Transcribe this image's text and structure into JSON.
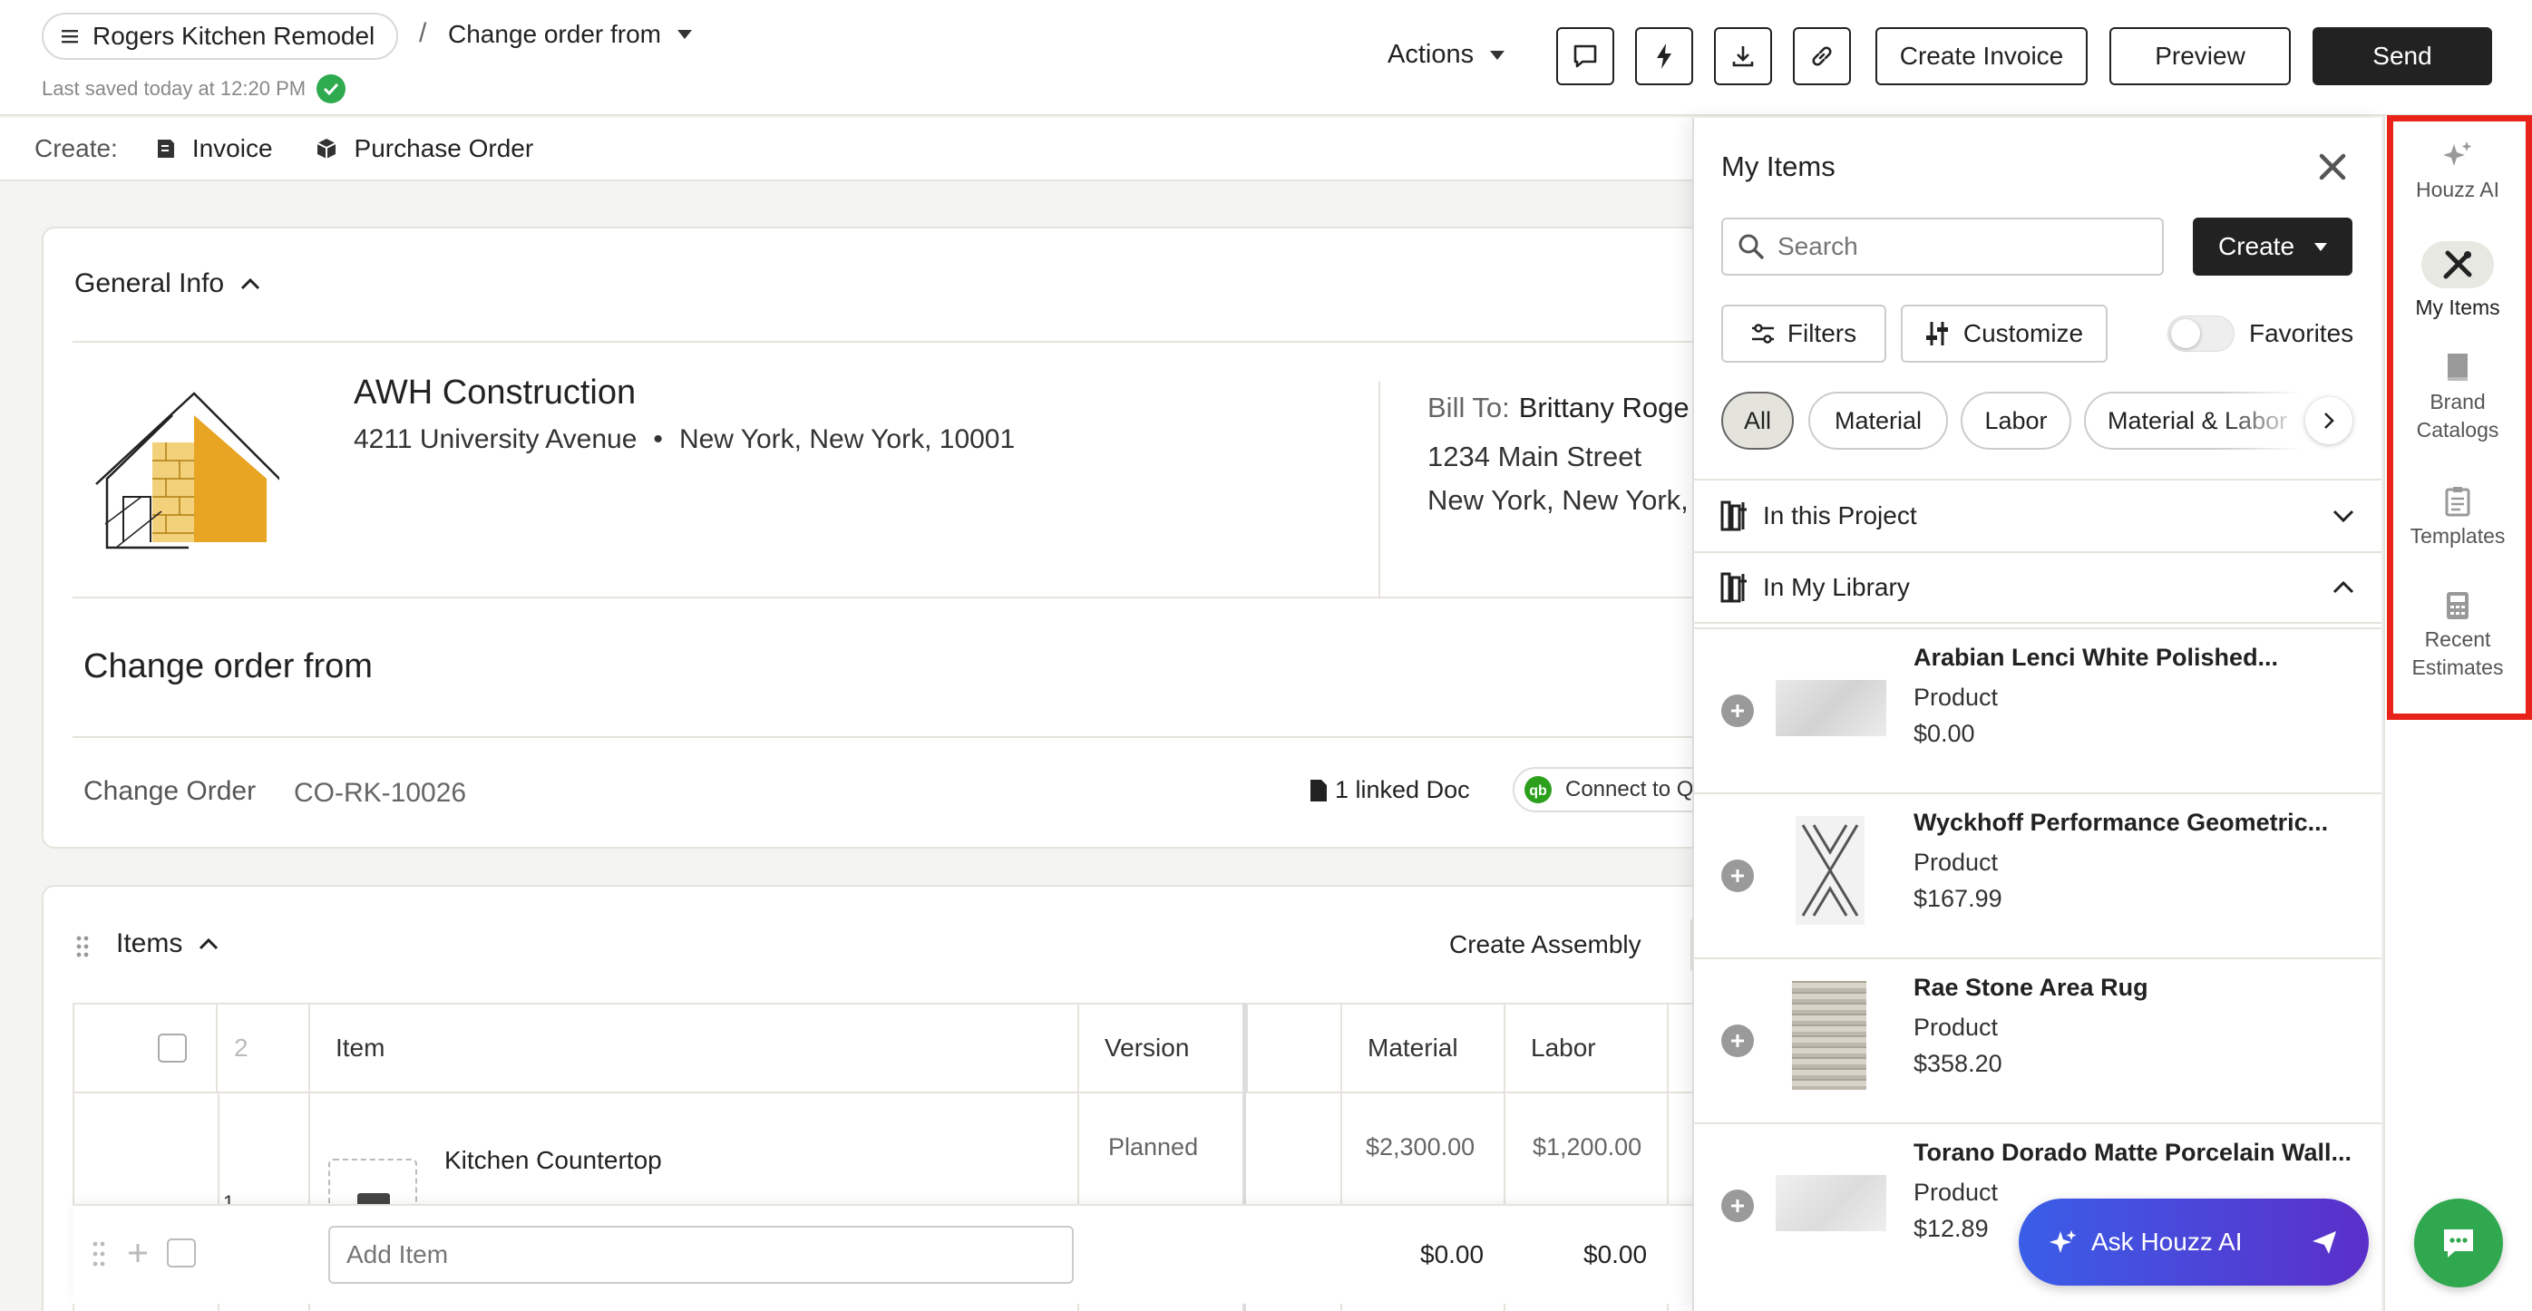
{
  "header": {
    "project_name": "Rogers Kitchen Remodel",
    "breadcrumb_sep": "/",
    "doc_title": "Change order from",
    "last_saved": "Last saved today at 12:20 PM",
    "actions_label": "Actions",
    "create_invoice_label": "Create Invoice",
    "preview_label": "Preview",
    "send_label": "Send",
    "icons": [
      "comment-icon",
      "lightning-icon",
      "download-icon",
      "link-icon"
    ]
  },
  "createbar": {
    "label": "Create:",
    "invoice_label": "Invoice",
    "purchase_order_label": "Purchase Order"
  },
  "general_info": {
    "title": "General Info",
    "company_name": "AWH Construction",
    "company_street": "4211 University Avenue",
    "company_dot": "•",
    "company_city": "New York, New York, 10001",
    "bill_to_label": "Bill To:",
    "bill_to_name": "Brittany Roge",
    "bill_street": "1234 Main Street",
    "bill_city": "New York, New York,"
  },
  "change_order": {
    "heading": "Change order from",
    "label": "Change Order",
    "number": "CO-RK-10026",
    "linked_docs": "1 linked Doc",
    "connect_label": "Connect to Q"
  },
  "items_section": {
    "title": "Items",
    "create_assembly_label": "Create Assembly",
    "count": "2",
    "columns": {
      "item": "Item",
      "version": "Version",
      "material": "Material",
      "labor": "Labor"
    },
    "rows": [
      {
        "index": "1",
        "name": "Kitchen Countertop",
        "version": "Planned",
        "material": "$2,300.00",
        "labor": "$1,200.00"
      }
    ],
    "add_item_placeholder": "Add Item",
    "add_material": "$0.00",
    "add_labor": "$0.00"
  },
  "panel": {
    "title": "My Items",
    "search_placeholder": "Search",
    "create_label": "Create",
    "filters_label": "Filters",
    "customize_label": "Customize",
    "favorites_label": "Favorites",
    "favorites_on": false,
    "chips": [
      "All",
      "Material",
      "Labor",
      "Material & Labor"
    ],
    "selected_chip": "All",
    "in_project_label": "In this Project",
    "in_library_label": "In My Library",
    "items": [
      {
        "name": "Arabian Lenci White Polished...",
        "type": "Product",
        "price": "$0.00"
      },
      {
        "name": "Wyckhoff Performance Geometric...",
        "type": "Product",
        "price": "$167.99"
      },
      {
        "name": "Rae Stone Area Rug",
        "type": "Product",
        "price": "$358.20"
      },
      {
        "name": "Torano Dorado Matte Porcelain Wall...",
        "type": "Product",
        "price": "$12.89"
      }
    ],
    "ask_ai_label": "Ask Houzz AI"
  },
  "rail": {
    "items": [
      {
        "label": "Houzz AI",
        "icon": "sparkle-icon"
      },
      {
        "label": "My Items",
        "icon": "tools-icon",
        "active": true
      },
      {
        "label": "Brand Catalogs",
        "icon": "book-icon"
      },
      {
        "label": "Templates",
        "icon": "clipboard-icon"
      },
      {
        "label": "Recent Estimates",
        "icon": "calculator-icon"
      }
    ],
    "rail_labels": {
      "houzz_ai": "Houzz AI",
      "my_items": "My Items",
      "brand1": "Brand",
      "brand2": "Catalogs",
      "templates": "Templates",
      "recent1": "Recent",
      "recent2": "Estimates"
    }
  },
  "colors": {
    "accent_dark": "#222222",
    "saved_check": "#2eaa4f",
    "highlight_box": "#e8231a",
    "chat_button": "#2fa84f",
    "ask_ai_gradient_start": "#3a5ee8",
    "ask_ai_gradient_end": "#5b2fc9",
    "logo_yellow": "#e8a423"
  }
}
